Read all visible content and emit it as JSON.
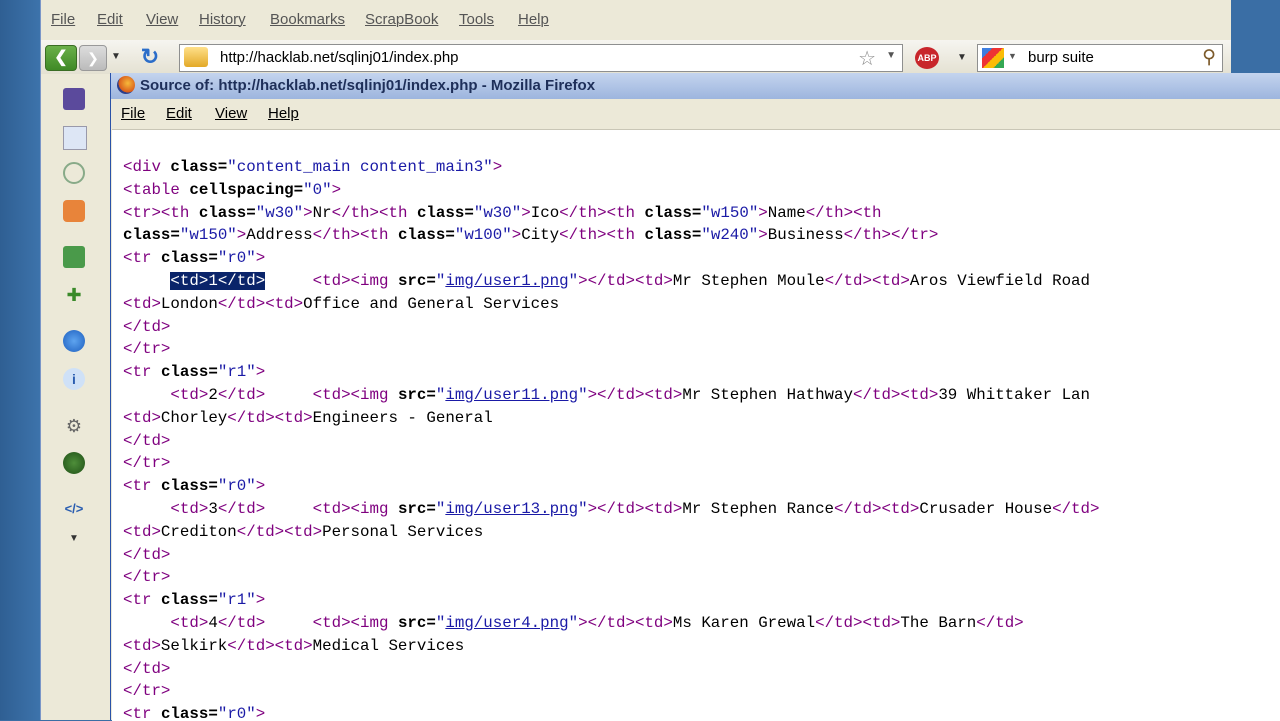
{
  "browser": {
    "menu": [
      "File",
      "Edit",
      "View",
      "History",
      "Bookmarks",
      "ScrapBook",
      "Tools",
      "Help"
    ],
    "url": "http://hacklab.net/sqlinj01/index.php",
    "search_text": "burp suite",
    "abp_label": "ABP"
  },
  "sidebar_icons": [
    "bookmark-manager-icon",
    "page-icon",
    "history-icon",
    "addon-icon",
    "download-icon",
    "puzzle-icon",
    "blue-orb-icon",
    "info-icon",
    "settings-gear-icon",
    "green-orb-icon",
    "code-icon",
    "dropdown-icon"
  ],
  "source_window": {
    "title": "Source of: http://hacklab.net/sqlinj01/index.php - Mozilla Firefox",
    "menu": [
      "File",
      "Edit",
      "View",
      "Help"
    ]
  },
  "code": {
    "class_content_main": "content_main content_main3",
    "cellspacing": "0",
    "th": [
      {
        "class": "w30",
        "text": "Nr"
      },
      {
        "class": "w30",
        "text": "Ico"
      },
      {
        "class": "w150",
        "text": "Name"
      },
      {
        "class": "w150",
        "text": "Address"
      },
      {
        "class": "w100",
        "text": "City"
      },
      {
        "class": "w240",
        "text": "Business"
      }
    ],
    "rows": [
      {
        "class": "r0",
        "nr": "1",
        "img": "img/user1.png",
        "name": "Mr Stephen Moule",
        "address": "Aros Viewfield Road",
        "city": "London",
        "business": "Office and General Services"
      },
      {
        "class": "r1",
        "nr": "2",
        "img": "img/user11.png",
        "name": "Mr Stephen Hathway",
        "address": "39 Whittaker Lan",
        "city": "Chorley",
        "business": "Engineers - General"
      },
      {
        "class": "r0",
        "nr": "3",
        "img": "img/user13.png",
        "name": "Mr Stephen Rance",
        "address": "Crusader House",
        "city": "Crediton",
        "business": "Personal Services"
      },
      {
        "class": "r1",
        "nr": "4",
        "img": "img/user4.png",
        "name": "Ms Karen Grewal",
        "address": "The Barn",
        "city": "Selkirk",
        "business": "Medical Services"
      }
    ],
    "last_row_class": "r0"
  }
}
